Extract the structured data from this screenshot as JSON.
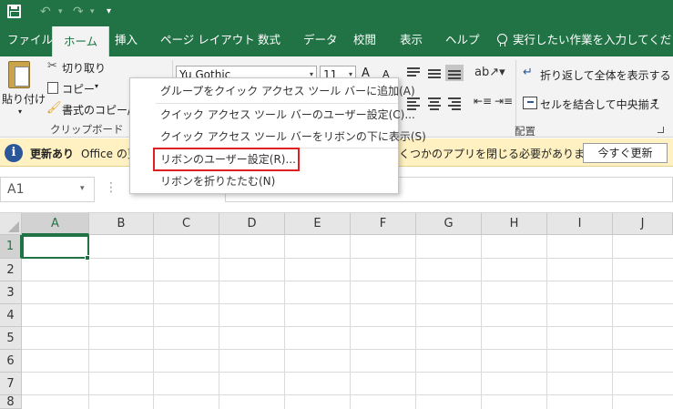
{
  "qat": {
    "save_icon": "save-icon",
    "undo_icon": "undo-icon",
    "redo_icon": "redo-icon",
    "customize_icon": "customize-qat-icon"
  },
  "tabs": [
    {
      "label": "ファイル"
    },
    {
      "label": "ホーム"
    },
    {
      "label": "挿入"
    },
    {
      "label": "ページ レイアウト"
    },
    {
      "label": "数式"
    },
    {
      "label": "データ"
    },
    {
      "label": "校閲"
    },
    {
      "label": "表示"
    },
    {
      "label": "ヘルプ"
    }
  ],
  "tell_me": "実行したい作業を入力してください",
  "ribbon": {
    "paste_label": "貼り付け",
    "cut_label": "切り取り",
    "copy_label": "コピー",
    "format_painter_label": "書式のコピー/貼",
    "clipboard_group": "クリップボード",
    "font_name": "Yu Gothic",
    "font_size": "11",
    "grow_font": "A",
    "shrink_font": "A",
    "wrap_text_label": "折り返して全体を表示する",
    "merge_label": "セルを結合して中央揃え",
    "alignment_group": "配置"
  },
  "infobar": {
    "title": "更新あり",
    "message_left": "Office の更",
    "message_right": "くつかのアプリを閉じる必要があります。",
    "button": "今すぐ更新"
  },
  "formula_bar": {
    "name_box": "A1",
    "dots": "⋮"
  },
  "grid": {
    "columns": [
      "A",
      "B",
      "C",
      "D",
      "E",
      "F",
      "G",
      "H",
      "I",
      "J"
    ],
    "rows": [
      "1",
      "2",
      "3",
      "4",
      "5",
      "6",
      "7",
      "8"
    ]
  },
  "context_menu": {
    "items": [
      "グループをクイック アクセス ツール バーに追加(A)",
      "クイック アクセス ツール バーのユーザー設定(C)...",
      "クイック アクセス ツール バーをリボンの下に表示(S)",
      "リボンのユーザー設定(R)...",
      "リボンを折りたたむ(N)"
    ]
  },
  "colors": {
    "excel_green": "#217346",
    "ribbon_bg": "#f3f3f3",
    "infobar_bg": "#fff1c1",
    "highlight_red": "#e02020"
  }
}
